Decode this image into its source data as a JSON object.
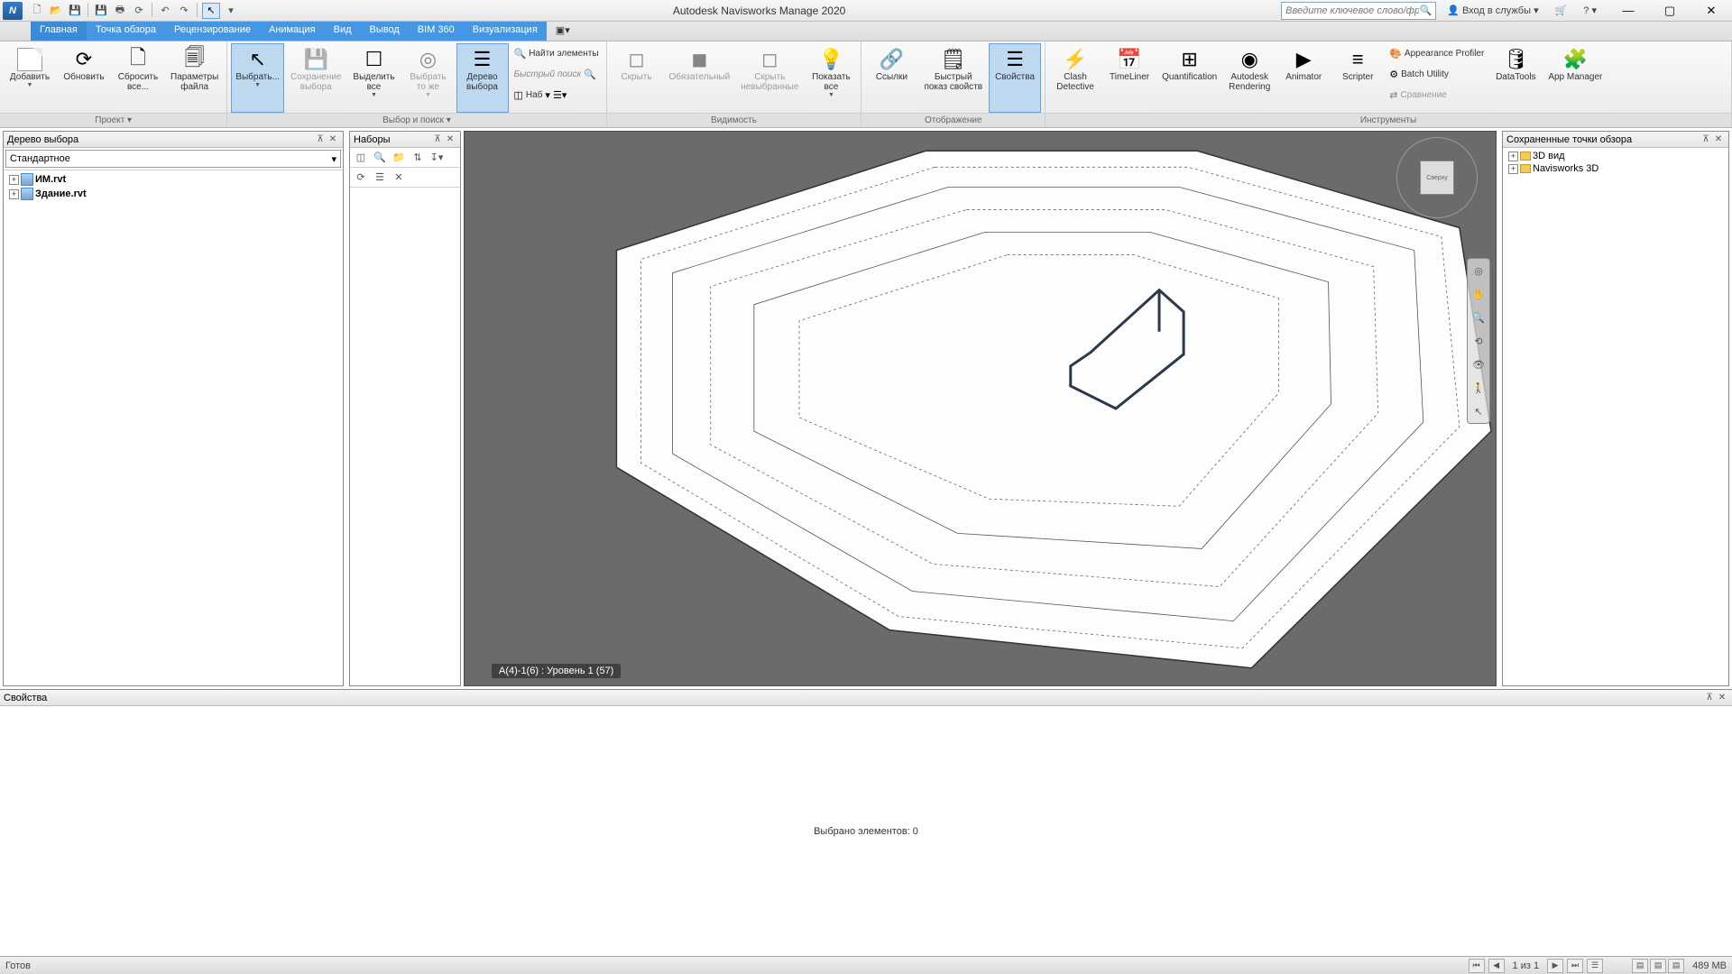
{
  "title": "Autodesk Navisworks Manage 2020",
  "search_placeholder": "Введите ключевое слово/фразу",
  "signin": "Вход в службы",
  "tabs": [
    "Главная",
    "Точка обзора",
    "Рецензирование",
    "Анимация",
    "Вид",
    "Вывод",
    "BIM 360",
    "Визуализация"
  ],
  "ribbon": {
    "project": {
      "add": "Добавить",
      "refresh": "Обновить",
      "reset": "Сбросить\nвсе...",
      "fileopts": "Параметры\nфайла",
      "label": "Проект ▾"
    },
    "select": {
      "select": "Выбрать...",
      "save_sel": "Сохранение\nвыбора",
      "select_all": "Выделить\nвсе",
      "select_same": "Выбрать\nто же",
      "sel_tree": "Дерево\nвыбора",
      "find": "Найти элементы",
      "quick": "Быстрый поиск",
      "sets": "Наб",
      "label": "Выбор и поиск ▾"
    },
    "visibility": {
      "hide": "Скрыть",
      "require": "Обязательный",
      "hide_un": "Скрыть\nневыбранные",
      "show_all": "Показать\nвсе",
      "label": "Видимость"
    },
    "display": {
      "links": "Ссылки",
      "quickprops": "Быстрый\nпоказ свойств",
      "props": "Свойства",
      "label": "Отображение"
    },
    "tools": {
      "clash": "Clash\nDetective",
      "timeliner": "TimeLiner",
      "quant": "Quantification",
      "render": "Autodesk\nRendering",
      "animator": "Animator",
      "scripter": "Scripter",
      "appprof": "Appearance Profiler",
      "batch": "Batch Utility",
      "compare": "Сравнение",
      "datatools": "DataTools",
      "appmgr": "App Manager",
      "label": "Инструменты"
    }
  },
  "panels": {
    "tree": {
      "title": "Дерево выбора",
      "combo": "Стандартное",
      "items": [
        "ИМ.rvt",
        "Здание.rvt"
      ]
    },
    "sets": {
      "title": "Наборы"
    },
    "viewpoints": {
      "title": "Сохраненные точки обзора",
      "items": [
        "3D вид",
        "Navisworks 3D"
      ]
    },
    "props": {
      "title": "Свойства",
      "msg": "Выбрано элементов: 0"
    }
  },
  "viewport": {
    "status": "A(4)-1(6) : Уровень 1 (57)",
    "cube": "Сверху"
  },
  "status": {
    "ready": "Готов",
    "page": "1 из 1",
    "mem": "489 MB"
  }
}
